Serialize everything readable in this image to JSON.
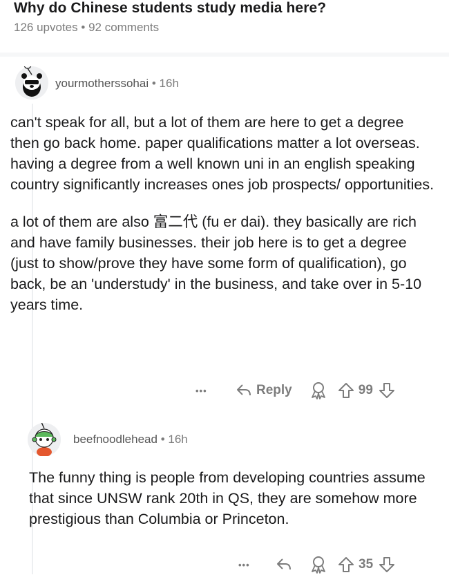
{
  "post": {
    "title": "Why do Chinese students study media here?",
    "upvotes": "126 upvotes",
    "dot": "•",
    "comments": "92 comments"
  },
  "comments": [
    {
      "author": "yourmotherssohai",
      "dot": "•",
      "time": "16h",
      "paragraphs": [
        "can't speak for all, but a lot of them are here to get a degree then go back home. paper qualifications matter a lot overseas. having a degree from a well known uni in an english speaking country significantly increases ones job prospects/ opportunities.",
        "a lot of them are also 富二代 (fu er dai). they basically are rich and have family businesses. their job here is to get a degree (just to show/prove they have some form of qualification), go back, be an 'understudy' in the business, and take over in 5-10 years time."
      ],
      "more": "•••",
      "reply_label": "Reply",
      "votes": "99"
    },
    {
      "author": "beefnoodlehead",
      "dot": "•",
      "time": "16h",
      "paragraphs": [
        "The funny thing is people from developing countries assume that since UNSW rank 20th in QS, they are somehow more prestigious than Columbia or Princeton."
      ],
      "more": "•••",
      "votes": "35"
    }
  ],
  "icons": {
    "more": "more-icon",
    "reply": "reply-arrow-icon",
    "award": "award-icon",
    "upvote": "upvote-arrow-icon",
    "downvote": "downvote-arrow-icon"
  }
}
